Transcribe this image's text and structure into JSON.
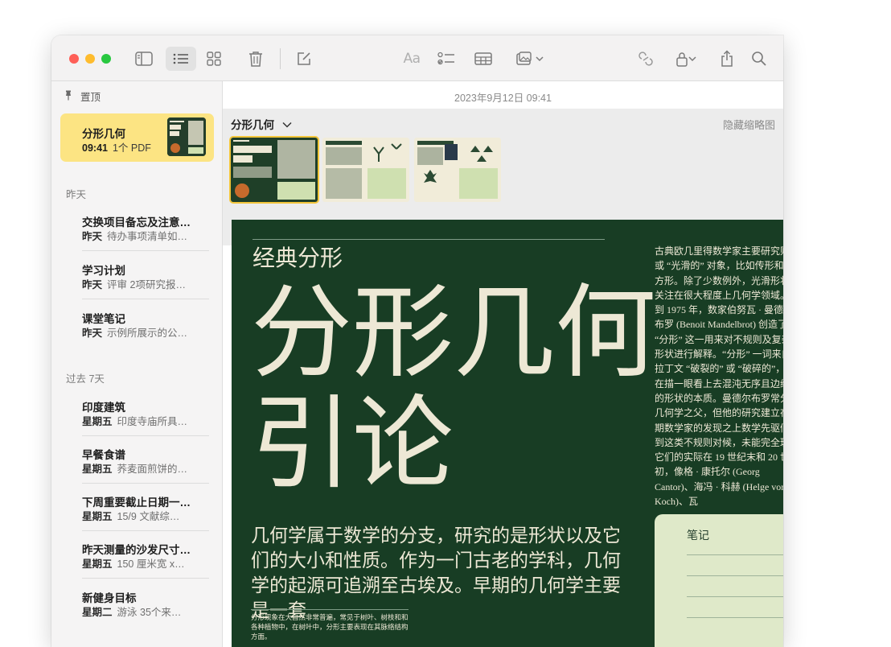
{
  "toolbar": {
    "icons": [
      "sidebar-toggle-icon",
      "list-view-icon",
      "gallery-view-icon",
      "trash-icon",
      "compose-icon",
      "format-text-icon",
      "checklist-icon",
      "table-icon",
      "media-icon",
      "collaborate-icon",
      "lock-icon",
      "share-icon",
      "search-icon"
    ],
    "format_label": "Aa"
  },
  "sidebar": {
    "pinned_label": "置顶",
    "selected_note": {
      "title": "分形几何",
      "time": "09:41",
      "subtitle": "1个 PDF"
    },
    "sections": [
      {
        "label": "昨天",
        "notes": [
          {
            "title": "交换项目备忘及注意…",
            "day": "昨天",
            "preview": "待办事项清单如…"
          },
          {
            "title": "学习计划",
            "day": "昨天",
            "preview": "评审 2项研究报…"
          },
          {
            "title": "课堂笔记",
            "day": "昨天",
            "preview": "示例所展示的公…"
          }
        ]
      },
      {
        "label": "过去 7天",
        "notes": [
          {
            "title": "印度建筑",
            "day": "星期五",
            "preview": "印度寺庙所具…"
          },
          {
            "title": "早餐食谱",
            "day": "星期五",
            "preview": "荞麦面煎饼的…"
          },
          {
            "title": "下周重要截止日期一…",
            "day": "星期五",
            "preview": "15/9 文献综…"
          },
          {
            "title": "昨天测量的沙发尺寸…",
            "day": "星期五",
            "preview": "150 厘米宽 x…"
          },
          {
            "title": "新健身目标",
            "day": "星期二",
            "preview": "游泳 35个来…"
          }
        ]
      }
    ]
  },
  "note": {
    "date": "2023年9月12日 09:41",
    "pdf_name": "分形几何",
    "hide_thumbnails": "隐藏缩略图",
    "page": {
      "kicker": "经典分形",
      "title_line1": "分形几何",
      "title_line2": "引论",
      "intro": "几何学属于数学的分支，研究的是形状以及它们的大小和性质。作为一门古老的学科，几何学的起源可追溯至古埃及。早期的几何学主要是一套",
      "small_text": "分形现象在大自然非常普遍，常见于树叶、树枝和和各种植物中，在树叶中，分形主要表现在其脉络结构方面。",
      "column_text": "古典欧几里得数学家主要研究则的或 “光滑的” 对象，比如传形和正方形。除了少数例外，光滑形状的关注在很大程度上几何学领域。直到 1975 年，数家伯努瓦 · 曼德尔布罗 (Benoit Mandelbrot) 创造了 “分形” 这一用来对不规则及复杂形状进行解释。“分形” 一词来自拉丁文 “破裂的” 或 “破碎的”，旨在描一眼看上去混沌无序且边缘参的形状的本质。曼德尔布罗常分形几何学之父，但他的研究建立在早期数学家的发现之上数学先驱们遇到这类不规则对候，未能完全理解它们的实际在 19 世纪末和 20 世纪初，像格 · 康托尔 (Georg Cantor)、海冯 · 科赫 (Helge von Koch)、瓦",
      "note_box_title": "笔记"
    }
  },
  "colors": {
    "selected_note": "#fce483",
    "page_bg": "#183d24",
    "page_text": "#ede8d5",
    "note_box": "#dfe9c9"
  }
}
